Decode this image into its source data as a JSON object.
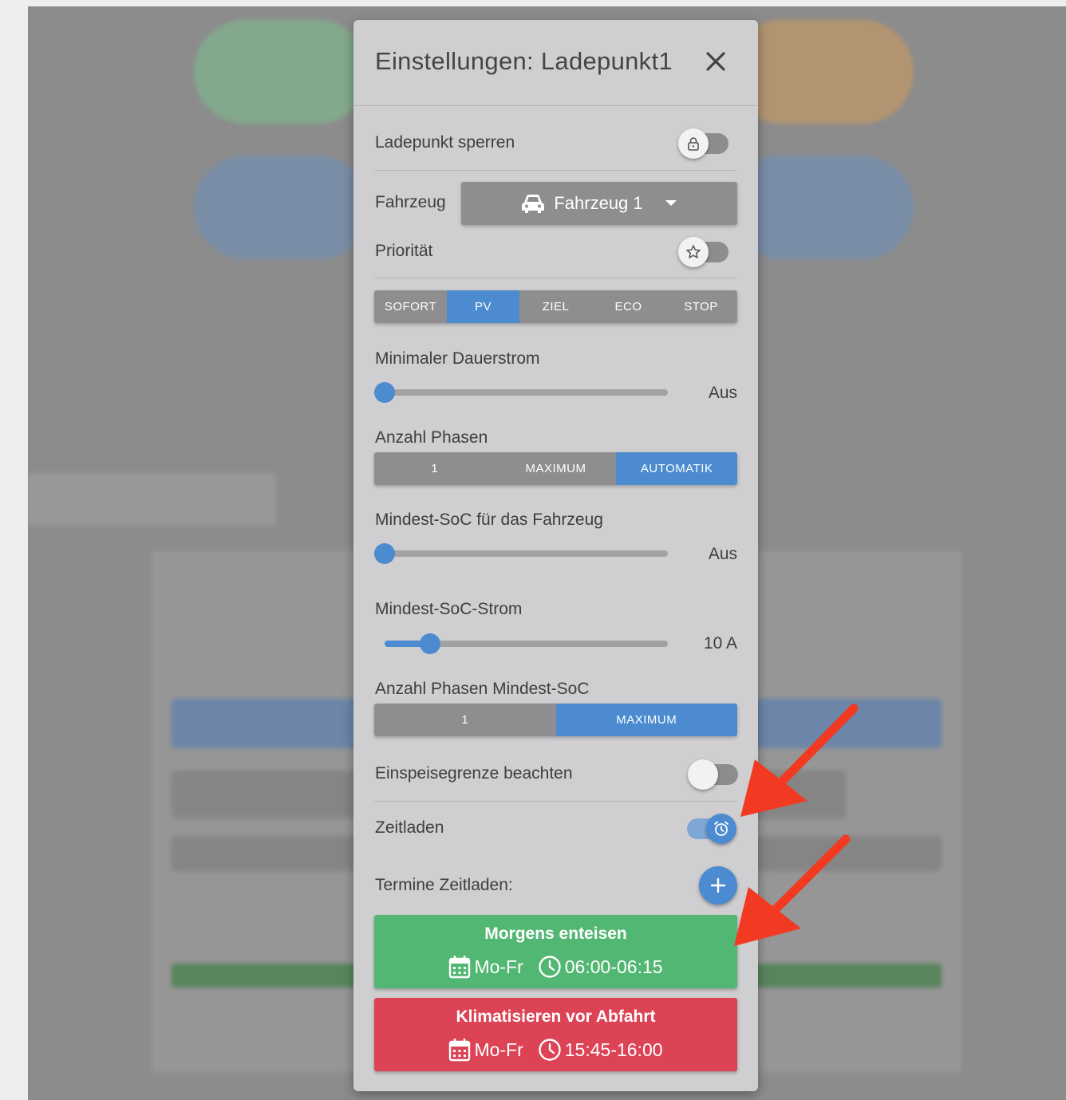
{
  "dialog": {
    "title": "Einstellungen: Ladepunkt1",
    "lock": {
      "label": "Ladepunkt sperren",
      "on": false
    },
    "vehicle": {
      "label": "Fahrzeug",
      "selected": "Fahrzeug 1"
    },
    "priority": {
      "label": "Priorität",
      "on": false
    },
    "charge_modes": {
      "options": [
        "SOFORT",
        "PV",
        "ZIEL",
        "ECO",
        "STOP"
      ],
      "active": "PV"
    },
    "min_current": {
      "label": "Minimaler Dauerstrom",
      "value_text": "Aus",
      "fraction": 0.0
    },
    "phases": {
      "label": "Anzahl Phasen",
      "options": [
        "1",
        "MAXIMUM",
        "AUTOMATIK"
      ],
      "active": "AUTOMATIK"
    },
    "min_soc": {
      "label": "Mindest-SoC für das Fahrzeug",
      "value_text": "Aus",
      "fraction": 0.0
    },
    "min_soc_current": {
      "label": "Mindest-SoC-Strom",
      "value_text": "10 A",
      "fraction": 0.16
    },
    "min_soc_phases": {
      "label": "Anzahl Phasen Mindest-SoC",
      "options": [
        "1",
        "MAXIMUM"
      ],
      "active": "MAXIMUM"
    },
    "feed_in_limit": {
      "label": "Einspeisegrenze beachten",
      "on": false
    },
    "timed_charging": {
      "label": "Zeitladen",
      "on": true
    },
    "schedules": {
      "label": "Termine Zeitladen:",
      "plans": [
        {
          "name": "Morgens enteisen",
          "days": "Mo-Fr",
          "time": "06:00-06:15",
          "color": "#52b772"
        },
        {
          "name": "Klimatisieren vor Abfahrt",
          "days": "Mo-Fr",
          "time": "15:45-16:00",
          "color": "#dc4456"
        }
      ]
    }
  },
  "colors": {
    "accent": "#4c8bcf",
    "arrow": "#f23a22"
  }
}
